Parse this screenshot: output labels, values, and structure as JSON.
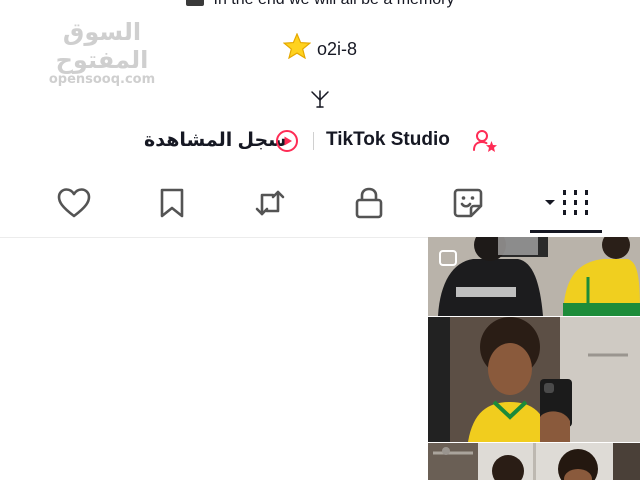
{
  "watermark": {
    "arabic": "السوق المفتوح",
    "latin": "opensooq.com"
  },
  "profile": {
    "bio": "In the end we will all be a memory",
    "star_name": "o2i-8",
    "link_icon": "tree-icon"
  },
  "links": {
    "studio_label": "TikTok Studio",
    "history_label": "سجل المشاهدة",
    "studio_icon": "person-star-icon",
    "history_icon": "play-circle-icon",
    "accent_color": "#fe2c55"
  },
  "tabs": {
    "items": [
      {
        "name": "grid",
        "icon": "grid-icon",
        "active": true
      },
      {
        "name": "stickers",
        "icon": "sticker-icon",
        "active": false
      },
      {
        "name": "private",
        "icon": "lock-icon",
        "active": false
      },
      {
        "name": "reposts",
        "icon": "repost-icon",
        "active": false
      },
      {
        "name": "favorites",
        "icon": "bookmark-icon",
        "active": false
      },
      {
        "name": "liked",
        "icon": "heart-icon",
        "active": false
      }
    ]
  },
  "grid": {
    "cells": [
      {
        "label": "",
        "description": ""
      },
      {
        "label": "",
        "description": ""
      },
      {
        "label": "",
        "description": ""
      }
    ]
  }
}
